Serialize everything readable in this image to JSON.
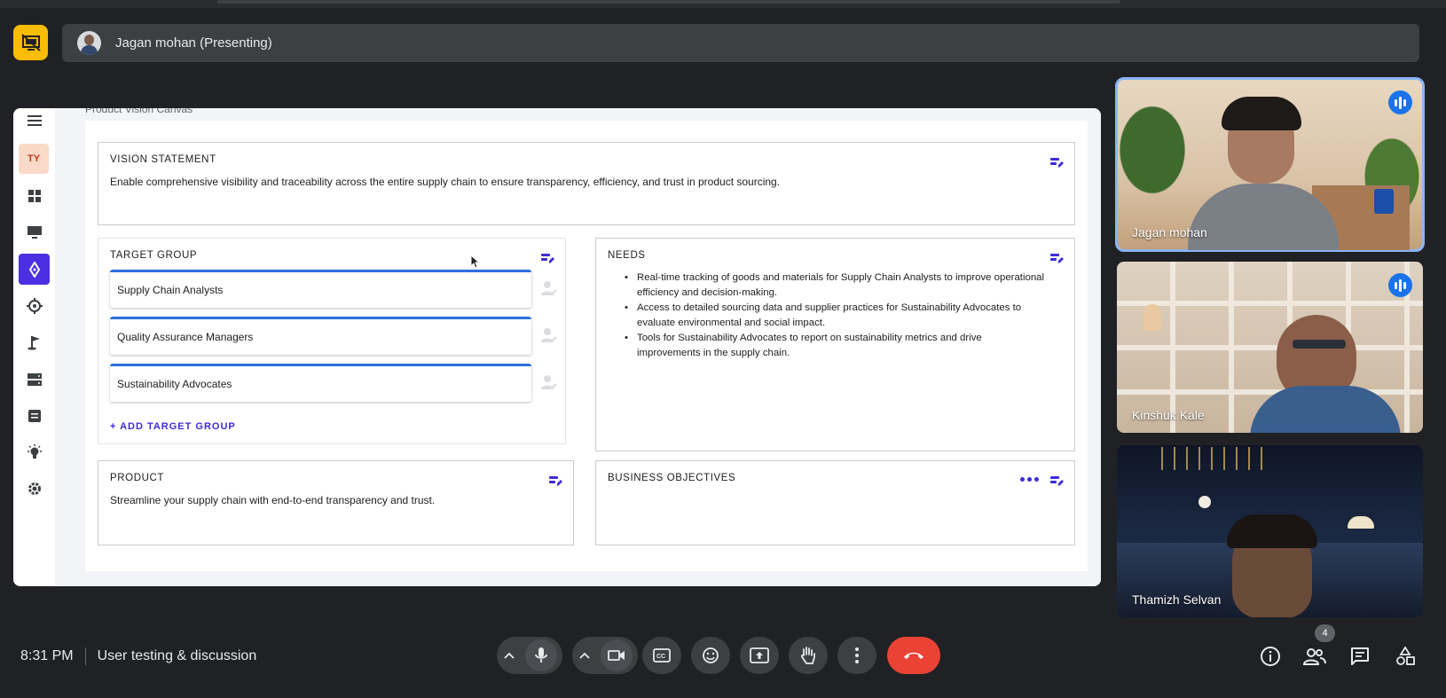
{
  "presenting": {
    "presenter_label": "Jagan mohan (Presenting)",
    "icon": "presentation-off-icon"
  },
  "shared_app": {
    "sidebar": {
      "badge_label": "TY",
      "items": [
        "menu-icon",
        "dashboard-icon",
        "monitor-icon",
        "compass-icon",
        "target-icon",
        "flag-icon",
        "server-icon",
        "notes-icon",
        "lightbulb-icon",
        "settings-icon"
      ]
    },
    "breadcrumb": "Product Vision Canvas",
    "vision": {
      "title": "VISION STATEMENT",
      "text": "Enable comprehensive visibility and traceability across the entire supply chain to ensure transparency, efficiency, and trust in product sourcing."
    },
    "target_group": {
      "title": "TARGET GROUP",
      "items": [
        "Supply Chain Analysts",
        "Quality Assurance Managers",
        "Sustainability Advocates"
      ],
      "add_label": "+ ADD TARGET GROUP"
    },
    "needs": {
      "title": "NEEDS",
      "items": [
        "Real-time tracking of goods and materials for Supply Chain Analysts to improve operational efficiency and decision-making.",
        "Access to detailed sourcing data and supplier practices for Sustainability Advocates to evaluate environmental and social impact.",
        "Tools for Sustainability Advocates to report on sustainability metrics and drive improvements in the supply chain."
      ]
    },
    "product": {
      "title": "PRODUCT",
      "text": "Streamline your supply chain with end-to-end transparency and trust."
    },
    "business_objectives": {
      "title": "BUSINESS OBJECTIVES",
      "text": ""
    },
    "accent_color": "#3d2bd8"
  },
  "participants": [
    {
      "name": "Jagan mohan",
      "speaking": true
    },
    {
      "name": "Kinshuk Kale",
      "speaking": true
    },
    {
      "name": "Thamizh Selvan",
      "speaking": false
    }
  ],
  "bottom_bar": {
    "time": "8:31 PM",
    "meeting_title": "User testing & discussion",
    "participant_count": "4",
    "controls": [
      "chevron-up-icon",
      "microphone-icon",
      "chevron-up-icon",
      "camera-icon",
      "captions-icon",
      "emoji-icon",
      "present-screen-icon",
      "raise-hand-icon",
      "more-options-icon",
      "end-call-icon"
    ],
    "right_icons": [
      "info-icon",
      "people-icon",
      "chat-icon",
      "activities-icon"
    ]
  }
}
